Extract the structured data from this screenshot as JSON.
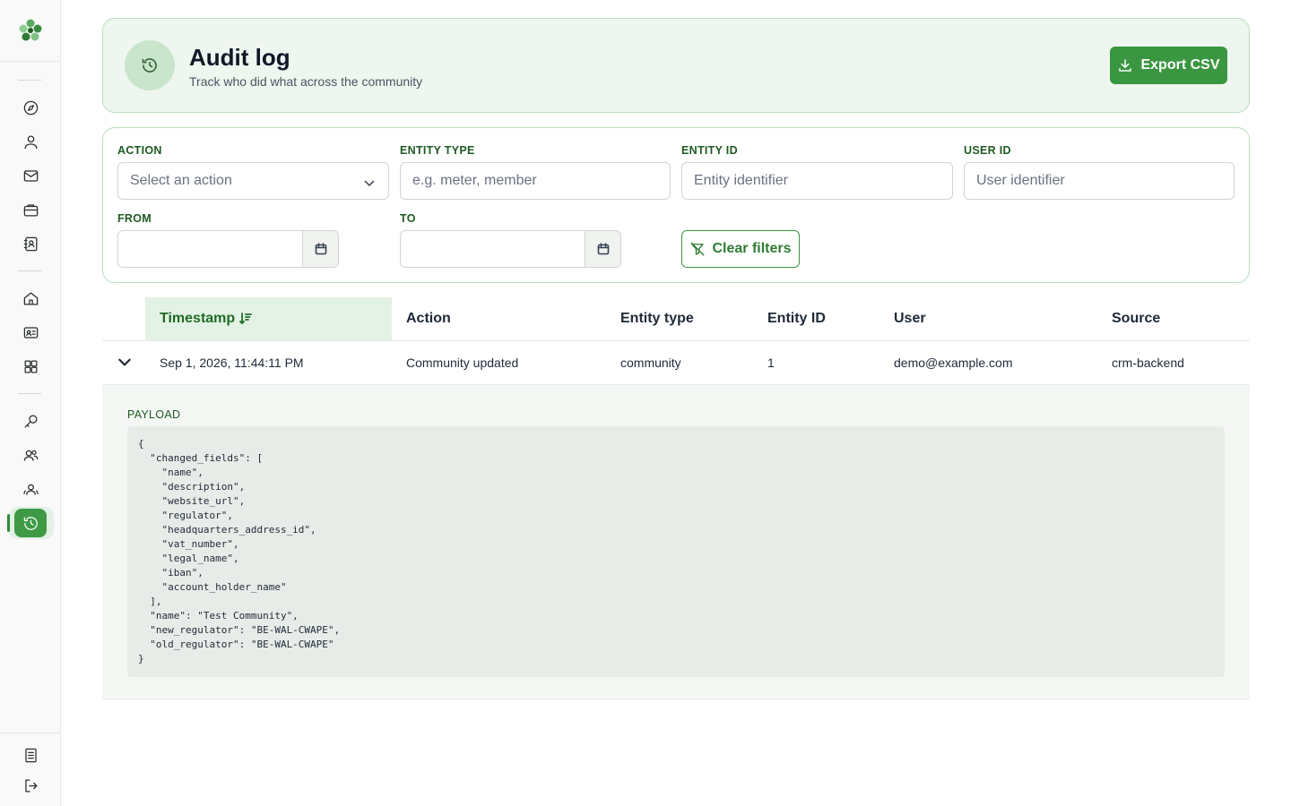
{
  "header": {
    "title": "Audit log",
    "subtitle": "Track who did what across the community",
    "export_label": "Export CSV"
  },
  "filters": {
    "action_label": "ACTION",
    "action_placeholder": "Select an action",
    "entity_type_label": "ENTITY TYPE",
    "entity_type_placeholder": "e.g. meter, member",
    "entity_id_label": "ENTITY ID",
    "entity_id_placeholder": "Entity identifier",
    "user_id_label": "USER ID",
    "user_id_placeholder": "User identifier",
    "from_label": "FROM",
    "to_label": "TO",
    "clear_label": "Clear filters"
  },
  "table": {
    "columns": [
      "Timestamp",
      "Action",
      "Entity type",
      "Entity ID",
      "User",
      "Source"
    ],
    "rows": [
      {
        "timestamp": "Sep 1, 2026, 11:44:11 PM",
        "action": "Community updated",
        "entity_type": "community",
        "entity_id": "1",
        "user": "demo@example.com",
        "source": "crm-backend"
      }
    ]
  },
  "expanded": {
    "payload_label": "PAYLOAD",
    "payload": "{\n  \"changed_fields\": [\n    \"name\",\n    \"description\",\n    \"website_url\",\n    \"regulator\",\n    \"headquarters_address_id\",\n    \"vat_number\",\n    \"legal_name\",\n    \"iban\",\n    \"account_holder_name\"\n  ],\n  \"name\": \"Test Community\",\n  \"new_regulator\": \"BE-WAL-CWAPE\",\n  \"old_regulator\": \"BE-WAL-CWAPE\"\n}"
  },
  "sidebar": {
    "icons": [
      "compass-icon",
      "user-icon",
      "mail-icon",
      "briefcase-icon",
      "contact-book-icon",
      "home-icon",
      "id-card-icon",
      "grid-icon",
      "key-icon",
      "users-icon",
      "group-icon",
      "history-icon",
      "document-icon",
      "logout-icon"
    ]
  },
  "colors": {
    "accent": "#3a9640",
    "header_bg": "#eef6ef",
    "border": "#b9dcbc"
  }
}
